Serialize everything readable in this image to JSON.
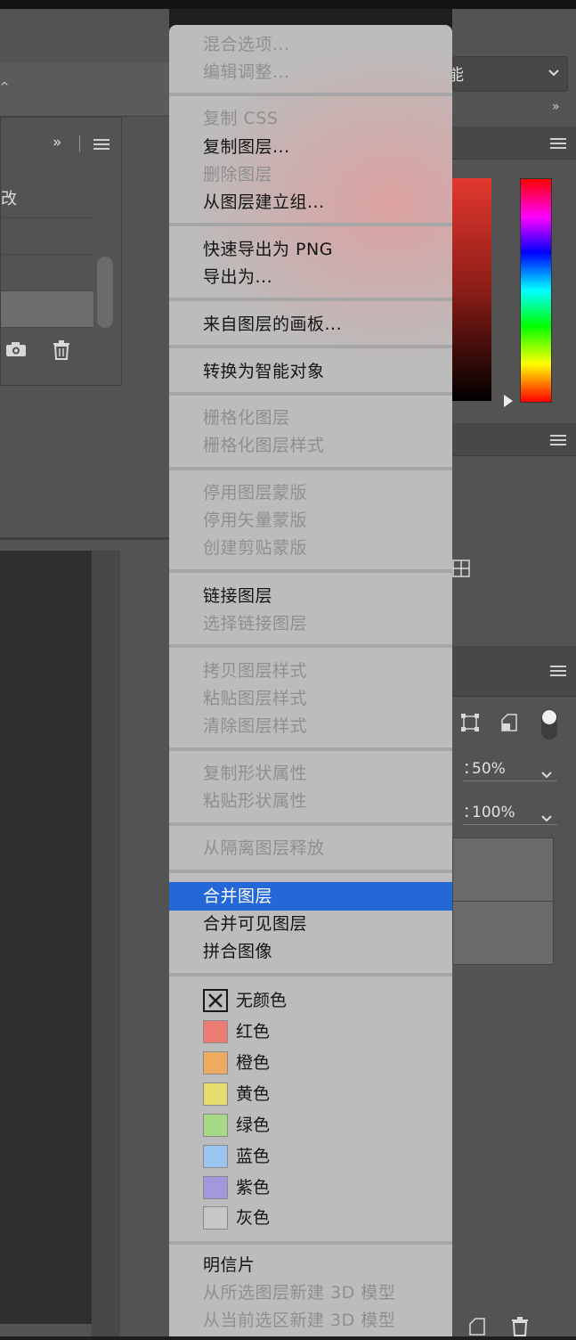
{
  "menu": {
    "groups": [
      {
        "items": [
          {
            "label": "混合选项...",
            "enabled": false
          },
          {
            "label": "编辑调整...",
            "enabled": false
          }
        ]
      },
      {
        "items": [
          {
            "label": "复制 CSS",
            "enabled": false
          },
          {
            "label": "复制图层...",
            "enabled": true
          },
          {
            "label": "删除图层",
            "enabled": false
          },
          {
            "label": "从图层建立组...",
            "enabled": true
          }
        ]
      },
      {
        "items": [
          {
            "label": "快速导出为 PNG",
            "enabled": true
          },
          {
            "label": "导出为...",
            "enabled": true
          }
        ]
      },
      {
        "items": [
          {
            "label": "来自图层的画板...",
            "enabled": true
          }
        ]
      },
      {
        "items": [
          {
            "label": "转换为智能对象",
            "enabled": true
          }
        ]
      },
      {
        "items": [
          {
            "label": "栅格化图层",
            "enabled": false
          },
          {
            "label": "栅格化图层样式",
            "enabled": false
          }
        ]
      },
      {
        "items": [
          {
            "label": "停用图层蒙版",
            "enabled": false
          },
          {
            "label": "停用矢量蒙版",
            "enabled": false
          },
          {
            "label": "创建剪贴蒙版",
            "enabled": false
          }
        ]
      },
      {
        "items": [
          {
            "label": "链接图层",
            "enabled": true
          },
          {
            "label": "选择链接图层",
            "enabled": false
          }
        ]
      },
      {
        "items": [
          {
            "label": "拷贝图层样式",
            "enabled": false
          },
          {
            "label": "粘贴图层样式",
            "enabled": false
          },
          {
            "label": "清除图层样式",
            "enabled": false
          }
        ]
      },
      {
        "items": [
          {
            "label": "复制形状属性",
            "enabled": false
          },
          {
            "label": "粘贴形状属性",
            "enabled": false
          }
        ]
      },
      {
        "items": [
          {
            "label": "从隔离图层释放",
            "enabled": false
          }
        ]
      },
      {
        "items": [
          {
            "label": "合并图层",
            "enabled": true,
            "highlighted": true
          },
          {
            "label": "合并可见图层",
            "enabled": true
          },
          {
            "label": "拼合图像",
            "enabled": true
          }
        ]
      }
    ],
    "colors": [
      {
        "label": "无颜色",
        "color": "none"
      },
      {
        "label": "红色",
        "color": "#ec7b73"
      },
      {
        "label": "橙色",
        "color": "#ecab5f"
      },
      {
        "label": "黄色",
        "color": "#e5dc6e"
      },
      {
        "label": "绿色",
        "color": "#a8d989"
      },
      {
        "label": "蓝色",
        "color": "#9ac5ef"
      },
      {
        "label": "紫色",
        "color": "#a497dc"
      },
      {
        "label": "灰色",
        "color": "#c7c7c7"
      }
    ],
    "bottom_items": [
      {
        "label": "明信片",
        "enabled": true
      },
      {
        "label": "从所选图层新建 3D 模型",
        "enabled": false
      },
      {
        "label": "从当前选区新建 3D 模型",
        "enabled": false
      }
    ],
    "highlight_color": "#2467d8"
  },
  "left_panel": {
    "row_text": "改"
  },
  "right_panel": {
    "dropdown_fragment": "能",
    "opacity_prefix": "：",
    "opacity": "50%",
    "fill_prefix": "：",
    "fill": "100%"
  }
}
